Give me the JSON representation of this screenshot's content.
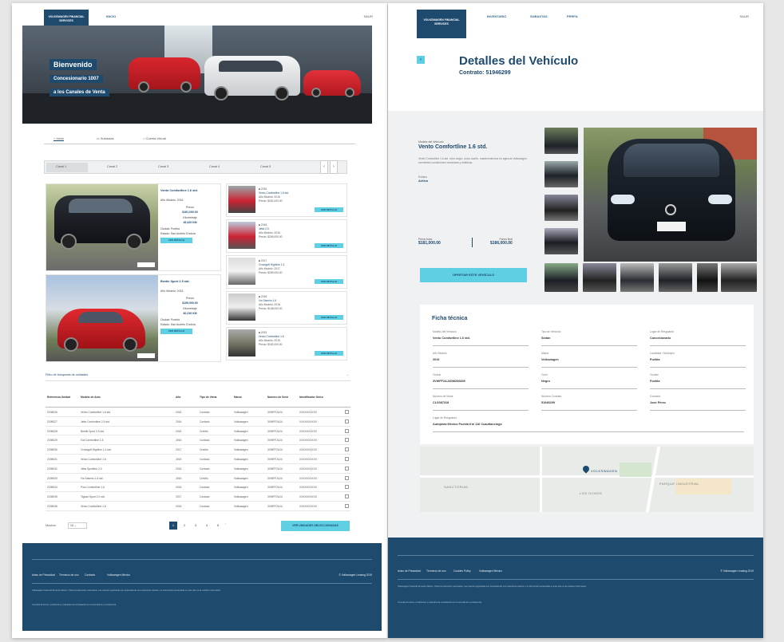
{
  "left_page": {
    "logo": "VOLKSWAGEN FINANCIAL SERVICES",
    "nav": [
      "INICIO"
    ],
    "lang": "SALIR",
    "hero": {
      "line1": "Bienvenido",
      "line2": "Concesionario 1007",
      "line3": "a los Canales de Venta"
    },
    "tabs": [
      "Inicio",
      "Subastas",
      "Cuenta Virtual"
    ],
    "filters": [
      "Canal 1",
      "Canal 2",
      "Canal 3",
      "Canal 4",
      "Canal 5"
    ],
    "big_listings": [
      {
        "title": "Vento Comfortline 1.6 std.",
        "lines": [
          "Año Modelo: 2016",
          "Precio",
          "$181,000.00",
          "Kilometraje",
          "45,320 KM",
          "Ciudad: Puebla",
          "Estado: San Andrés Cholula"
        ],
        "btn": "VER DETALLE"
      },
      {
        "title": "Beetle Sport 2.5 std.",
        "lines": [
          "Año Modelo: 2015",
          "Precio",
          "$159,900.00",
          "Kilometraje",
          "60,230 KM",
          "Ciudad: Puebla",
          "Estado: San Andrés Cholula"
        ],
        "btn": "VER DETALLE"
      }
    ],
    "small_listings": [
      {
        "tag": "2016",
        "title": "Vento Comfortline 1.6 std.",
        "l1": "Año Modelo: 2016",
        "l2": "Precio: $181,000.00",
        "btn": "VER DETALLE"
      },
      {
        "tag": "2016",
        "title": "Jetta 2.5",
        "l1": "Año Modelo: 2016",
        "l2": "Precio: $206,000.00",
        "btn": "VER DETALLE"
      },
      {
        "tag": "2017",
        "title": "Crossgolf Highline 1.4",
        "l1": "Año Modelo: 2017",
        "l2": "Precio: $259,000.00",
        "btn": "VER DETALLE"
      },
      {
        "tag": "2016",
        "title": "Vw Saveiro 1.6",
        "l1": "Año Modelo: 2016",
        "l2": "Precio: $148,000.00",
        "btn": "VER DETALLE"
      },
      {
        "tag": "2015",
        "title": "Vento Comfortline 1.6",
        "l1": "Año Modelo: 2015",
        "l2": "Precio: $162,000.00",
        "btn": "VER DETALLE"
      }
    ],
    "filter_title": "Filtro de búsqueda de unidades",
    "table": {
      "headers": [
        "Referencia Unidad",
        "Modelo de Auto",
        "Año",
        "Tipo de Venta",
        "Marca",
        "Número de Serie",
        "Identificador Único"
      ],
      "rows": [
        [
          "2198026",
          "Vento Comfortline 1.6 std.",
          "2016",
          "Contado",
          "Volkswagen",
          "3VWFF2AJ4",
          "XXXXXXXXXX"
        ],
        [
          "2198027",
          "Jetta Comfortline 2.5 std.",
          "2016",
          "Contado",
          "Volkswagen",
          "3VWFF2AJ4",
          "XXXXXXXXXX"
        ],
        [
          "2198028",
          "Beetle Sport 2.5 std.",
          "2015",
          "Crédito",
          "Volkswagen",
          "3VWFF2AJ4",
          "XXXXXXXXXX"
        ],
        [
          "2198029",
          "Gol Comfortline 1.6",
          "2016",
          "Contado",
          "Volkswagen",
          "3VWFF2AJ4",
          "XXXXXXXXXX"
        ],
        [
          "2198030",
          "Crossgolf Highline 1.4 std.",
          "2017",
          "Crédito",
          "Volkswagen",
          "3VWFF2AJ4",
          "XXXXXXXXXX"
        ],
        [
          "2198031",
          "Vento Comfortline 1.6",
          "2015",
          "Contado",
          "Volkswagen",
          "3VWFF2AJ4",
          "XXXXXXXXXX"
        ],
        [
          "2198032",
          "Jetta Sportline 2.0",
          "2016",
          "Contado",
          "Volkswagen",
          "3VWFF2AJ4",
          "XXXXXXXXXX"
        ],
        [
          "2198033",
          "Vw Saveiro 1.6 std.",
          "2016",
          "Crédito",
          "Volkswagen",
          "3VWFF2AJ4",
          "XXXXXXXXXX"
        ],
        [
          "2198034",
          "Polo Comfortline 1.6",
          "2016",
          "Contado",
          "Volkswagen",
          "3VWFF2AJ4",
          "XXXXXXXXXX"
        ],
        [
          "2198035",
          "Tiguan Sport 2.0 std.",
          "2017",
          "Contado",
          "Volkswagen",
          "3VWFF2AJ4",
          "XXXXXXXXXX"
        ],
        [
          "2198036",
          "Vento Comfortline 1.6",
          "2016",
          "Contado",
          "Volkswagen",
          "3VWFF2AJ4",
          "XXXXXXXXXX"
        ]
      ]
    },
    "pagination": {
      "label": "Mostrar",
      "pages": [
        "1",
        "2",
        "3",
        "4",
        "5"
      ],
      "btn": "VER UNIDADES SELECCIONADAS"
    },
    "footer": {
      "links": [
        "Aviso de Privacidad",
        "Términos de uso",
        "Contacto",
        "Volkswagen México"
      ],
      "copyright": "© Volkswagen Leasing 2019",
      "legal1": "Volkswagen Financial Services México. Todos los derechos reservados. Las marcas registradas son propiedad de sus respectivos dueños. La información presentada en este sitio es de carácter informativo.",
      "legal2": "Consulta términos, condiciones y requisitos de contratación en la sucursal de tu preferencia."
    }
  },
  "right_page": {
    "logo": "VOLKSWAGEN FINANCIAL SERVICES",
    "nav": [
      "INVENTARIO",
      "SUBASTAS",
      "PERFIL"
    ],
    "lang": "SALIR",
    "back": "‹",
    "title": "Detalles del Vehículo",
    "subtitle": "Contrato: 51946299",
    "vehicle": {
      "label": "Modelo del Vehículo",
      "name": "Vento Comfortline 1.6 std.",
      "description": "Vento Comfortline 1.6 std. color negro, único dueño, mantenimientos en agencia Volkswagen, excelentes condiciones mecánicas y estéticas.",
      "status_label": "Estatus",
      "status": "Activo",
      "price1_label": "Precio base",
      "price1": "$181,000.00",
      "price2_label": "Precio final",
      "price2": "$186,000.00",
      "btn": "OFERTAR ESTE VEHÍCULO"
    },
    "ficha": {
      "title": "Ficha técnica",
      "fields": [
        {
          "label": "Modelo del Vehículo",
          "value": "Vento Comfortline 1.6 std."
        },
        {
          "label": "Tipo de Vehículo",
          "value": "Sedán"
        },
        {
          "label": "Lugar de Resguardo",
          "value": "Concesionario"
        },
        {
          "label": "Año Modelo",
          "value": "2016"
        },
        {
          "label": "Marca",
          "value": "Volkswagen"
        },
        {
          "label": "Localidad / Municipio",
          "value": "Puebla"
        },
        {
          "label": "Chasis",
          "value": "3VWFF2AJ4GM206839"
        },
        {
          "label": "Color",
          "value": "Negro"
        },
        {
          "label": "Ciudad",
          "value": "Puebla"
        },
        {
          "label": "Número de Motor",
          "value": "CLS087318"
        },
        {
          "label": "Número Contrato",
          "value": "51946299"
        },
        {
          "label": "Contacto",
          "value": "José Pérez"
        },
        {
          "label": "Lugar de Resguardo",
          "value": "Autopista México Puebla Km 116 Cuautlancingo"
        }
      ]
    },
    "map": {
      "labels": [
        "VOLKSWAGEN",
        "SANCTORUM",
        "LOS OCHOS",
        "PARQUE INDUSTRIAL"
      ]
    },
    "footer": {
      "links": [
        "Aviso de Privacidad",
        "Términos de uso",
        "Cookies Policy",
        "Volkswagen México"
      ],
      "copyright": "© Volkswagen Leasing 2019",
      "legal1": "Volkswagen Financial Services México. Todos los derechos reservados. Las marcas registradas son propiedad de sus respectivos dueños. La información presentada en este sitio es de carácter informativo.",
      "legal2": "Consulta términos, condiciones y requisitos de contratación en la sucursal de tu preferencia."
    }
  },
  "colors": {
    "brand": "#1e4a6e",
    "accent": "#5fd0e3",
    "background": "#e6e6e6"
  }
}
